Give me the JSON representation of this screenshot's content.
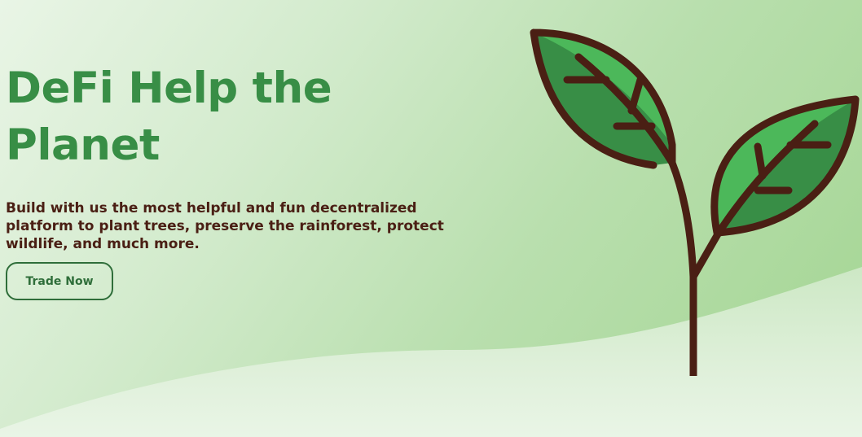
{
  "hero": {
    "title": "DeFi Help the Planet",
    "subtitle": "Build with us the most helpful and fun decentralized platform to plant trees, preserve the rainforest, protect wildlife, and much more.",
    "cta_label": "Trade Now"
  },
  "illustration": {
    "icon": "sprout-icon"
  },
  "colors": {
    "title": "#388e46",
    "subtitle": "#4a1f14",
    "button_border": "#2f6e3a",
    "leaf_dark": "#388e46",
    "leaf_light": "#4cb85a",
    "stem": "#4a1f14"
  }
}
